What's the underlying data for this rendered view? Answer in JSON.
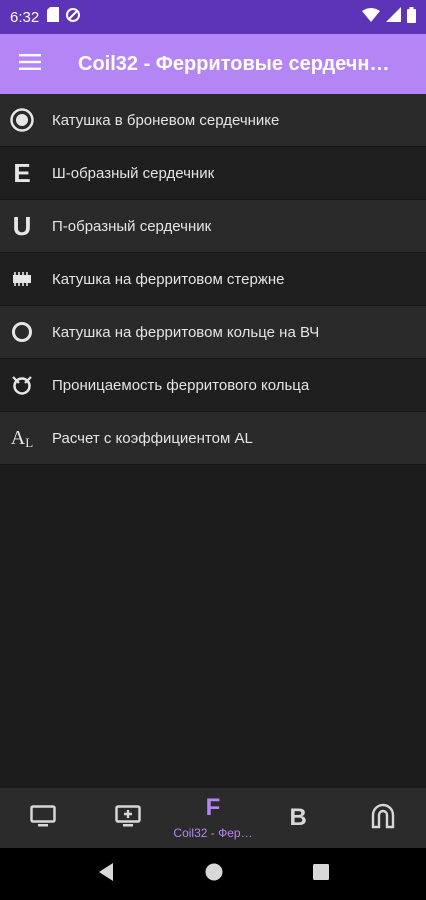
{
  "status_bar": {
    "time": "6:32",
    "icons": [
      "sd-card-icon",
      "data-saver-icon",
      "wifi-icon",
      "signal-icon",
      "battery-icon"
    ]
  },
  "app_bar": {
    "title": "Coil32 - Ферритовые сердечн…",
    "menu_icon": "menu-icon",
    "color": "#b486f5"
  },
  "list": {
    "items": [
      {
        "label": "Катушка в броневом сердечнике",
        "icon": "pot-core-icon"
      },
      {
        "label": "Ш-образный сердечник",
        "icon": "e-core-icon",
        "glyph": "E"
      },
      {
        "label": "П-образный сердечник",
        "icon": "u-core-icon",
        "glyph": "U"
      },
      {
        "label": "Катушка на ферритовом стержне",
        "icon": "rod-core-icon"
      },
      {
        "label": "Катушка на ферритовом кольце на ВЧ",
        "icon": "ring-core-icon"
      },
      {
        "label": "Проницаемость ферритового кольца",
        "icon": "permeability-icon"
      },
      {
        "label": "Расчет с коэффициентом AL",
        "icon": "al-icon",
        "glyph_a": "A",
        "glyph_l": "L"
      }
    ]
  },
  "bottom_nav": {
    "items": [
      {
        "icon": "monitor-icon"
      },
      {
        "icon": "monitor-plus-icon"
      },
      {
        "icon": "ferrite-icon",
        "glyph": "F",
        "label": "Coil32 - Фер…",
        "active": true
      },
      {
        "icon": "b-icon",
        "glyph": "B"
      },
      {
        "icon": "magnet-icon"
      }
    ]
  },
  "colors": {
    "status_bar": "#5d33b8",
    "accent": "#b486f5",
    "background": "#1c1c1c"
  }
}
